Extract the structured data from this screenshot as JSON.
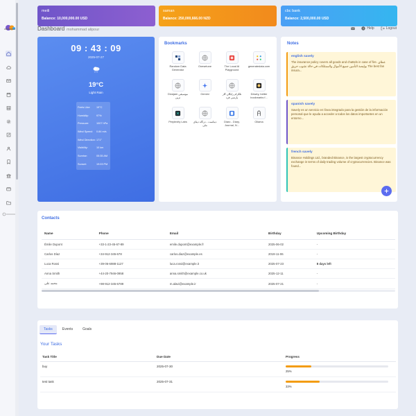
{
  "balances": [
    {
      "name": "meili",
      "balance": "Balance: 10,000,000.00 USD",
      "color": "#7a58cc"
    },
    {
      "name": "saman",
      "balance": "Balance: 250,000,666.00 NZD",
      "color": "#f39a1b"
    },
    {
      "name": "cbc bank",
      "balance": "Balance: 2,500,000.00 USD",
      "color": "#42a9f3"
    }
  ],
  "header": {
    "title": "Dashboard",
    "user": "mohammad alipour",
    "help": "Help",
    "logout": "Logout"
  },
  "sidebar": {
    "icons": [
      "home-icon",
      "cloud-icon",
      "mail-icon",
      "calendar-icon",
      "calendar-grid-icon",
      "settings-icon",
      "edit-icon",
      "user-icon",
      "bookmark-icon",
      "bank-icon",
      "wallet-icon",
      "folder-icon"
    ],
    "active": "home-icon"
  },
  "weather": {
    "time": "09 : 43 : 09",
    "date": "2025-07-27",
    "temperature": "19°C",
    "condition": "Light Rain",
    "details": [
      {
        "label": "Feels Like:",
        "value": "19°C"
      },
      {
        "label": "Humidity:",
        "value": "97%"
      },
      {
        "label": "Pressure:",
        "value": "1007 hPa"
      },
      {
        "label": "Wind Speed:",
        "value": "0.84 m/s"
      },
      {
        "label": "Wind Direction:",
        "value": "171°"
      },
      {
        "label": "Visibility:",
        "value": "10 km"
      },
      {
        "label": "Sunrise:",
        "value": "05:35 AM"
      },
      {
        "label": "Sunset:",
        "value": "19:03 PM"
      }
    ]
  },
  "bookmarks": {
    "title": "Bookmarks",
    "items": [
      {
        "label": "Random Data Generator",
        "icon": "grid-icon"
      },
      {
        "label": "Onesetune",
        "icon": "globe-icon"
      },
      {
        "label": "The Local AI Playground",
        "icon": "red-ai-icon"
      },
      {
        "label": "generatedata.com",
        "icon": "dots-icon"
      },
      {
        "label": "Divajam موسیقی ترین",
        "icon": "globe-icon"
      },
      {
        "label": "Gemini",
        "icon": "gemini-icon"
      },
      {
        "label": "تلگرام رایگان کار پارسی فرد",
        "icon": "globe-icon"
      },
      {
        "label": "Dewey, better bookmarks f...",
        "icon": "dewey-icon"
      },
      {
        "label": "Perplexity Labs",
        "icon": "perplexity-icon"
      },
      {
        "label": "دیتاست - درگاه دیتای ملی",
        "icon": "globe-icon"
      },
      {
        "label": "Diaro - Diary, Journal, N...",
        "icon": "diaro-icon"
      },
      {
        "label": "Ollama",
        "icon": "ollama-icon"
      }
    ]
  },
  "notes": {
    "title": "Notes",
    "items": [
      {
        "title": "english savely",
        "body": "The insurance policy covers all goods and chattels in case of fire. غطاي بوليصة التأمين جميع الأموال والممتلكات في حالة نشوب حريق The best fan insura...",
        "color": "#f39c12"
      },
      {
        "title": "spanish savely",
        "body": "Savely es un servicio en línea integrado para la gestión de la información personal que le ayuda a acceder a todos los datos importantes en un entorno...",
        "color": "#6f55c9"
      },
      {
        "title": "french savely",
        "body": "Binance Holdings Ltd., branded Binance, is the largest cryptocurrency exchange in terms of daily trading volume of cryptocurrencies. Binance was found...",
        "color": "#2ec4b6"
      }
    ]
  },
  "contacts": {
    "title": "Contacts",
    "columns": [
      "Name",
      "Phone",
      "Email",
      "Birthday",
      "Upcoming Birthday"
    ],
    "rows": [
      [
        "Émile Dupont",
        "+33-1-23-45-67-89",
        "emile.dupont@example.fr",
        "2025-06-02",
        "-"
      ],
      [
        "Carlos Díaz",
        "+34-912-345-678",
        "carlos.diaz@example.es",
        "2019-11-06",
        "-"
      ],
      [
        "Luca Rossi",
        "+39-06-6988-1127",
        "luca.rossi@example.it",
        "2025-07-23",
        "8 days left"
      ],
      [
        "Anna Smith",
        "+44-20-7946-0958",
        "anna.smith@example.co.uk",
        "2025-12-11",
        "-"
      ],
      [
        "محمد علی",
        "+98-912-345-6789",
        "m.alavi@example.ir",
        "2025-07-21",
        "-"
      ]
    ]
  },
  "tasks": {
    "tabs": [
      "Tasks",
      "Events",
      "Goals"
    ],
    "active_tab": "Tasks",
    "heading": "Your Tasks",
    "columns": [
      "Task Title",
      "Due Date",
      "Progress"
    ],
    "rows": [
      {
        "title": "buy",
        "due": "2025-07-30",
        "progress": 25,
        "progress_text": "25%"
      },
      {
        "title": "test task",
        "due": "2025-07-31",
        "progress": 33,
        "progress_text": "33%"
      }
    ],
    "progress_color": "#f39c12"
  }
}
